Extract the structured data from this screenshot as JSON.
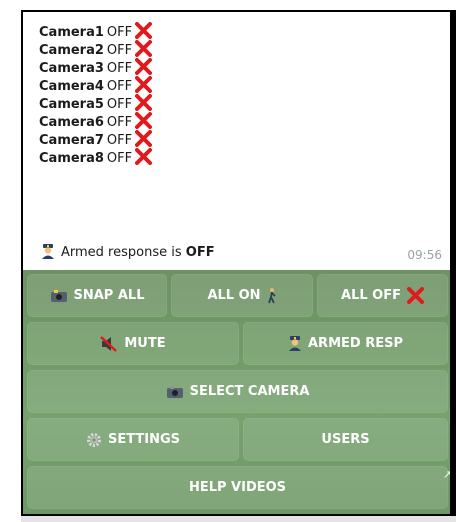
{
  "message": {
    "cameras": [
      {
        "name": "Camera1",
        "state": "OFF"
      },
      {
        "name": "Camera2",
        "state": "OFF"
      },
      {
        "name": "Camera3",
        "state": "OFF"
      },
      {
        "name": "Camera4",
        "state": "OFF"
      },
      {
        "name": "Camera5",
        "state": "OFF"
      },
      {
        "name": "Camera6",
        "state": "OFF"
      },
      {
        "name": "Camera7",
        "state": "OFF"
      },
      {
        "name": "Camera8",
        "state": "OFF"
      }
    ],
    "armed_prefix": "Armed response is",
    "armed_state": "OFF",
    "time": "09:56"
  },
  "keyboard": {
    "snap_all": "SNAP ALL",
    "all_on": "ALL ON",
    "all_off": "ALL OFF",
    "mute": "MUTE",
    "armed_resp": "ARMED RESP",
    "select_camera": "SELECT CAMERA",
    "settings": "SETTINGS",
    "users": "USERS",
    "help_videos": "HELP VIDEOS"
  },
  "colors": {
    "cross": "#e0191e",
    "keyboard_bg": "#6f9a66",
    "time": "#9aa3a8"
  }
}
